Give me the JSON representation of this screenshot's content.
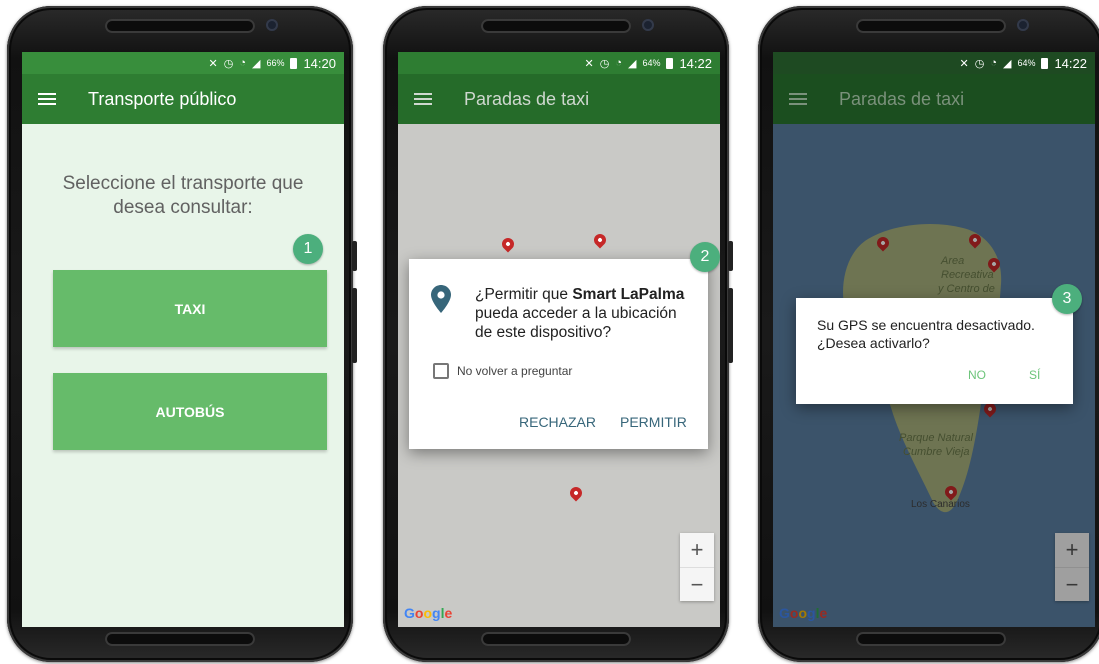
{
  "phone1": {
    "status": {
      "battery": "66%",
      "time": "14:20"
    },
    "appbar_title": "Transporte público",
    "prompt": "Seleccione el transporte que desea consultar:",
    "buttons": {
      "taxi": "TAXI",
      "bus": "AUTOBÚS"
    },
    "badge": "1",
    "colors": {
      "statusbar": "#388e3c",
      "appbar": "#2e7d32",
      "button": "#66bb6a",
      "background": "#e8f5e9"
    }
  },
  "phone2": {
    "status": {
      "battery": "64%",
      "time": "14:22"
    },
    "appbar_title": "Paradas de taxi",
    "dialog": {
      "line1_prefix": "¿Permitir que",
      "app_name": "Smart LaPalma",
      "line2": "pueda acceder a la ubicación",
      "line3": "de este dispositivo?",
      "checkbox_label": "No volver a preguntar",
      "reject": "RECHAZAR",
      "allow": "PERMITIR"
    },
    "badge": "2",
    "zoom": {
      "in": "+",
      "out": "−"
    },
    "google": {
      "g1": "G",
      "o1": "o",
      "o2": "o",
      "g2": "g",
      "l": "l",
      "e": "e"
    }
  },
  "phone3": {
    "status": {
      "battery": "64%",
      "time": "14:22"
    },
    "appbar_title": "Paradas de taxi",
    "map_labels": {
      "area1": "Area",
      "area2": "Recreativa",
      "area3": "y Centro de",
      "parque1": "Parque Natural",
      "parque2": "Cumbre Vieja",
      "canarios": "Los Canarios"
    },
    "dialog": {
      "line1": "Su GPS se encuentra desactivado.",
      "line2": "¿Desea activarlo?",
      "no": "NO",
      "yes": "SÍ"
    },
    "badge": "3",
    "zoom": {
      "in": "+",
      "out": "−"
    },
    "google": {
      "g1": "G",
      "o1": "o",
      "o2": "o",
      "g2": "g",
      "l": "l",
      "e": "e"
    }
  },
  "icons": [
    "menu-icon",
    "mute-icon",
    "alarm-icon",
    "wifi-icon",
    "signal-icon",
    "battery-icon",
    "location-pin-icon",
    "map-marker-icon"
  ]
}
